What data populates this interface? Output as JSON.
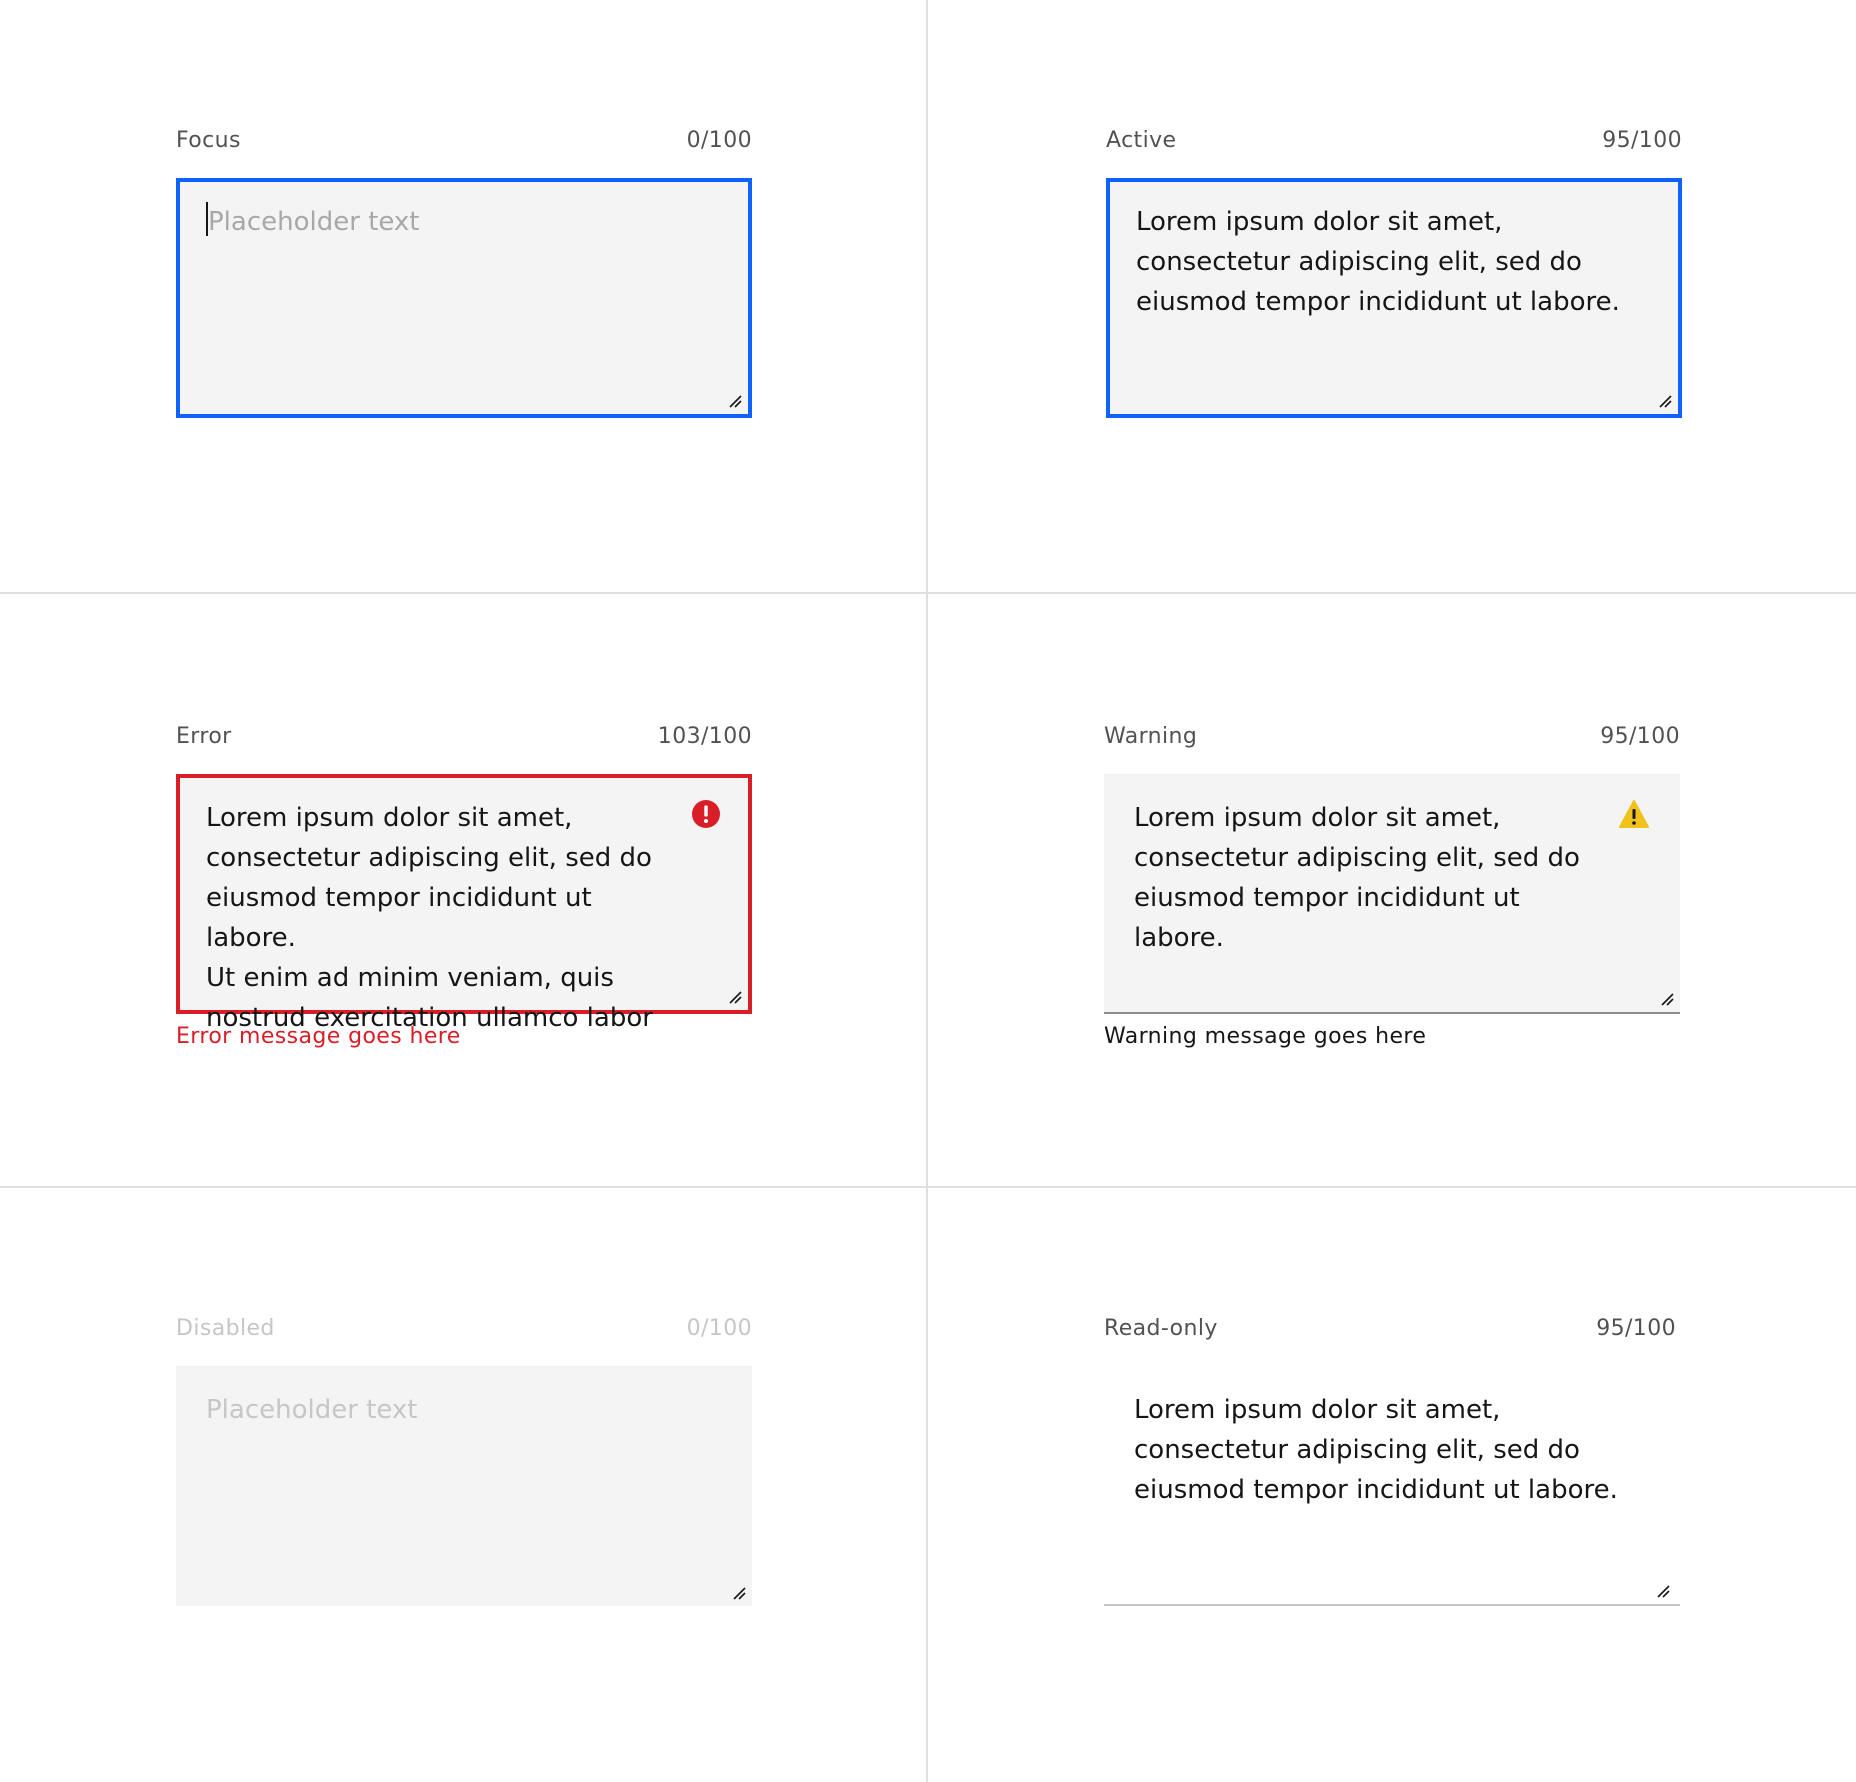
{
  "focus": {
    "label": "Focus",
    "counter": "0/100",
    "placeholder": "Placeholder text"
  },
  "active": {
    "label": "Active",
    "counter": "95/100",
    "value": "Lorem ipsum dolor sit amet,\nconsectetur adipiscing elit, sed do\neiusmod tempor incididunt ut labore."
  },
  "error": {
    "label": "Error",
    "counter": "103/100",
    "value": "Lorem ipsum dolor sit amet,\nconsectetur adipiscing elit, sed do\neiusmod tempor incididunt ut labore.\nUt enim ad minim veniam, quis\nnostrud exercitation ullamco labor",
    "message": "Error message goes here",
    "icon": "error-filled-icon"
  },
  "warning": {
    "label": "Warning",
    "counter": "95/100",
    "value": "Lorem ipsum dolor sit amet,\nconsectetur adipiscing elit, sed do\neiusmod tempor incididunt ut labore.",
    "message": "Warning message goes here",
    "icon": "warning-filled-icon"
  },
  "disabled": {
    "label": "Disabled",
    "counter": "0/100",
    "placeholder": "Placeholder text"
  },
  "readonly": {
    "label": "Read-only",
    "counter": "95/100",
    "value": "Lorem ipsum dolor sit amet,\nconsectetur adipiscing elit, sed do\neiusmod tempor incididunt ut labore."
  },
  "colors": {
    "focus_border": "#0f62fe",
    "error": "#da1e28",
    "warning": "#f1c21b",
    "field_bg": "#f4f4f4",
    "text": "#161616",
    "label": "#525252",
    "disabled": "#c6c6c6"
  }
}
